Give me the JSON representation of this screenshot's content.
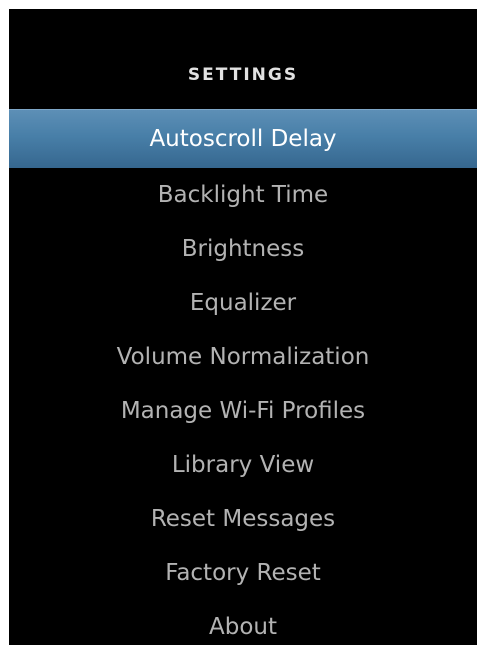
{
  "header": {
    "title": "SETTINGS"
  },
  "menu": {
    "selected_index": 0,
    "items": [
      {
        "label": "Autoscroll Delay"
      },
      {
        "label": "Backlight Time"
      },
      {
        "label": "Brightness"
      },
      {
        "label": "Equalizer"
      },
      {
        "label": "Volume Normalization"
      },
      {
        "label": "Manage Wi-Fi Profiles"
      },
      {
        "label": "Library View"
      },
      {
        "label": "Reset Messages"
      },
      {
        "label": "Factory Reset"
      },
      {
        "label": "About"
      }
    ]
  },
  "colors": {
    "background": "#000000",
    "selection": "#487fa8",
    "text": "#b3b3b3",
    "selected_text": "#ffffff"
  }
}
